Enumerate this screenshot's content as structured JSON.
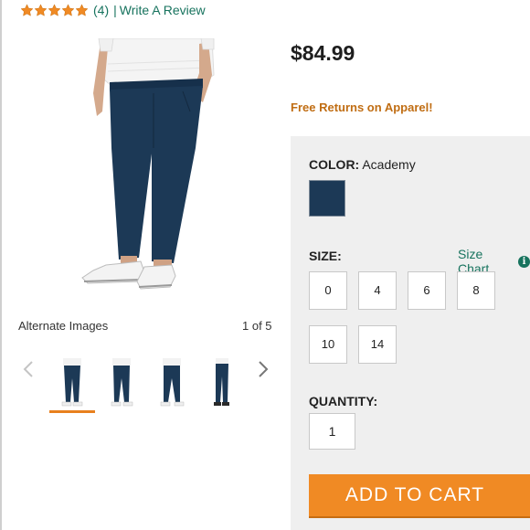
{
  "rating": {
    "stars": 5,
    "count_text": "(4)",
    "separator": "|",
    "review_link": "Write A Review"
  },
  "gallery": {
    "alt_label": "Alternate Images",
    "page_indicator": "1 of 5",
    "thumbnails": [
      "front-view",
      "front-view-2",
      "back-view",
      "side-view"
    ],
    "selected_index": 0
  },
  "product": {
    "price": "$84.99",
    "promo": "Free Returns on Apparel!"
  },
  "color": {
    "label": "COLOR:",
    "value": "Academy",
    "swatch_hex": "#1c3956"
  },
  "size": {
    "label": "SIZE:",
    "chart_link": "Size Chart",
    "options": [
      "0",
      "4",
      "6",
      "8",
      "10",
      "14"
    ]
  },
  "quantity": {
    "label": "QUANTITY:",
    "value": "1"
  },
  "cart": {
    "button_label": "ADD TO CART"
  },
  "colors": {
    "accent_orange": "#f08a24",
    "link_green": "#17735e",
    "promo_orange": "#c06d13",
    "pant_navy": "#1c3956"
  }
}
